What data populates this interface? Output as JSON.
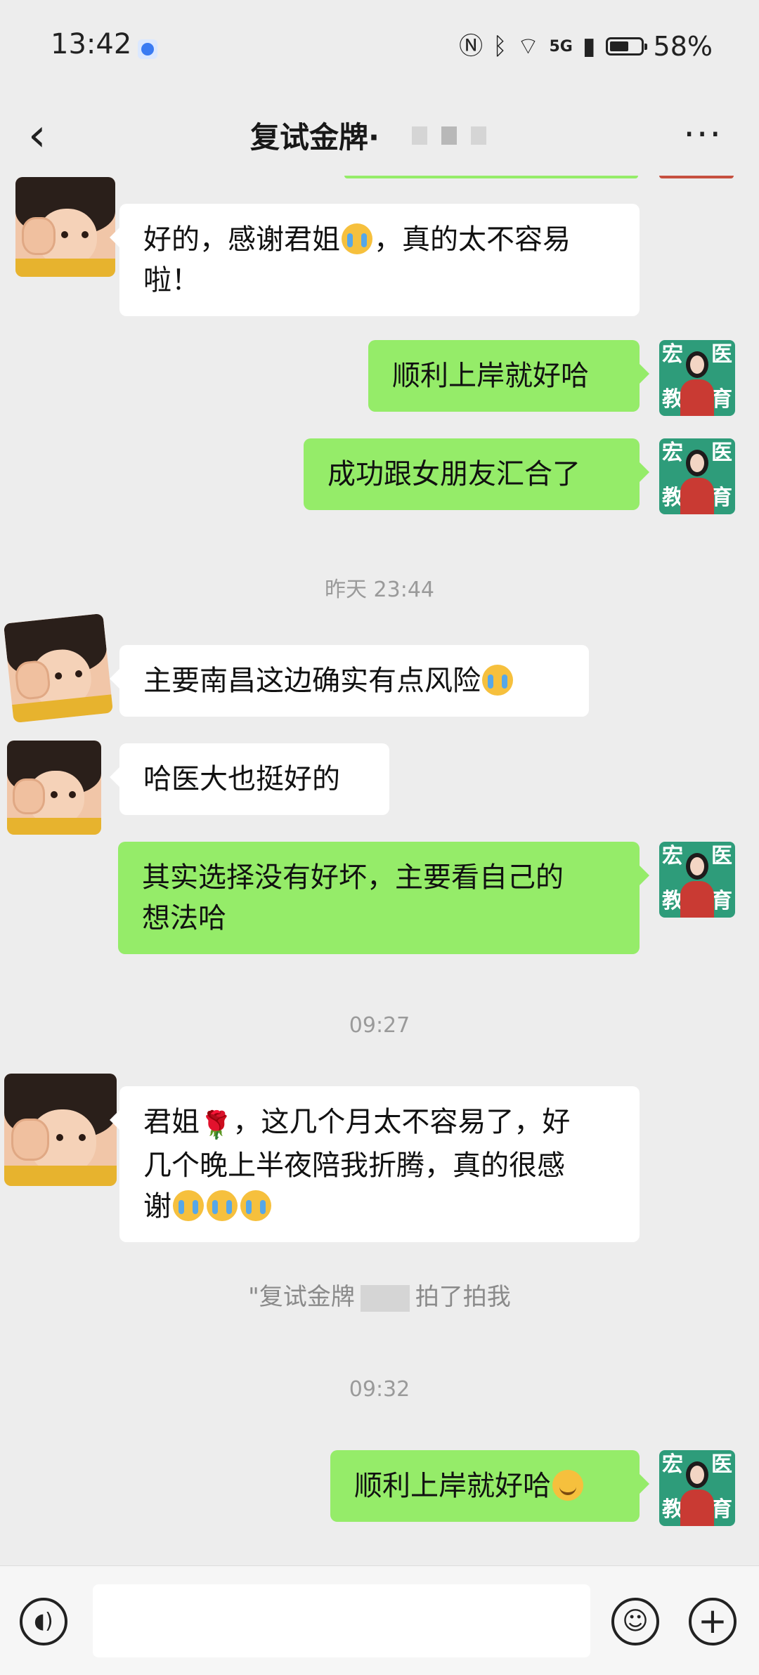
{
  "status_bar": {
    "time": "13:42",
    "network": "5G",
    "battery": "58%"
  },
  "header": {
    "title": "复试金牌·",
    "back_icon": "chevron-left-icon",
    "more_label": "···"
  },
  "messages": [
    {
      "side": "in",
      "lines": [
        "好的，感谢君姐",
        "，真的太不容易",
        "啦！"
      ]
    },
    {
      "side": "out",
      "text": "顺利上岸就好哈"
    },
    {
      "side": "out",
      "text": "成功跟女朋友汇合了"
    },
    {
      "side": "in",
      "text": "主要南昌这边确实有点风险"
    },
    {
      "side": "in",
      "text": "哈医大也挺好的"
    },
    {
      "side": "out",
      "lines": [
        "其实选择没有好坏，主要看自己的",
        "想法哈"
      ]
    },
    {
      "side": "in",
      "lines": [
        "君姐",
        "，这几个月太不容易了，好",
        "几个晚上半夜陪我折腾，真的很感",
        "谢"
      ]
    },
    {
      "side": "out",
      "text": "顺利上岸就好哈"
    }
  ],
  "timestamps": [
    "昨天 23:44",
    "09:27",
    "09:32"
  ],
  "system_message": {
    "prefix": "\"复试金牌",
    "suffix": "拍了拍我"
  },
  "avatar_agent": {
    "top_left": "宏",
    "top_right": "医",
    "bottom_left": "教",
    "bottom_right": "育"
  },
  "input_bar": {
    "placeholder": ""
  },
  "colors": {
    "outgoing_bubble": "#95ec69",
    "incoming_bubble": "#ffffff",
    "background": "#ededed"
  }
}
